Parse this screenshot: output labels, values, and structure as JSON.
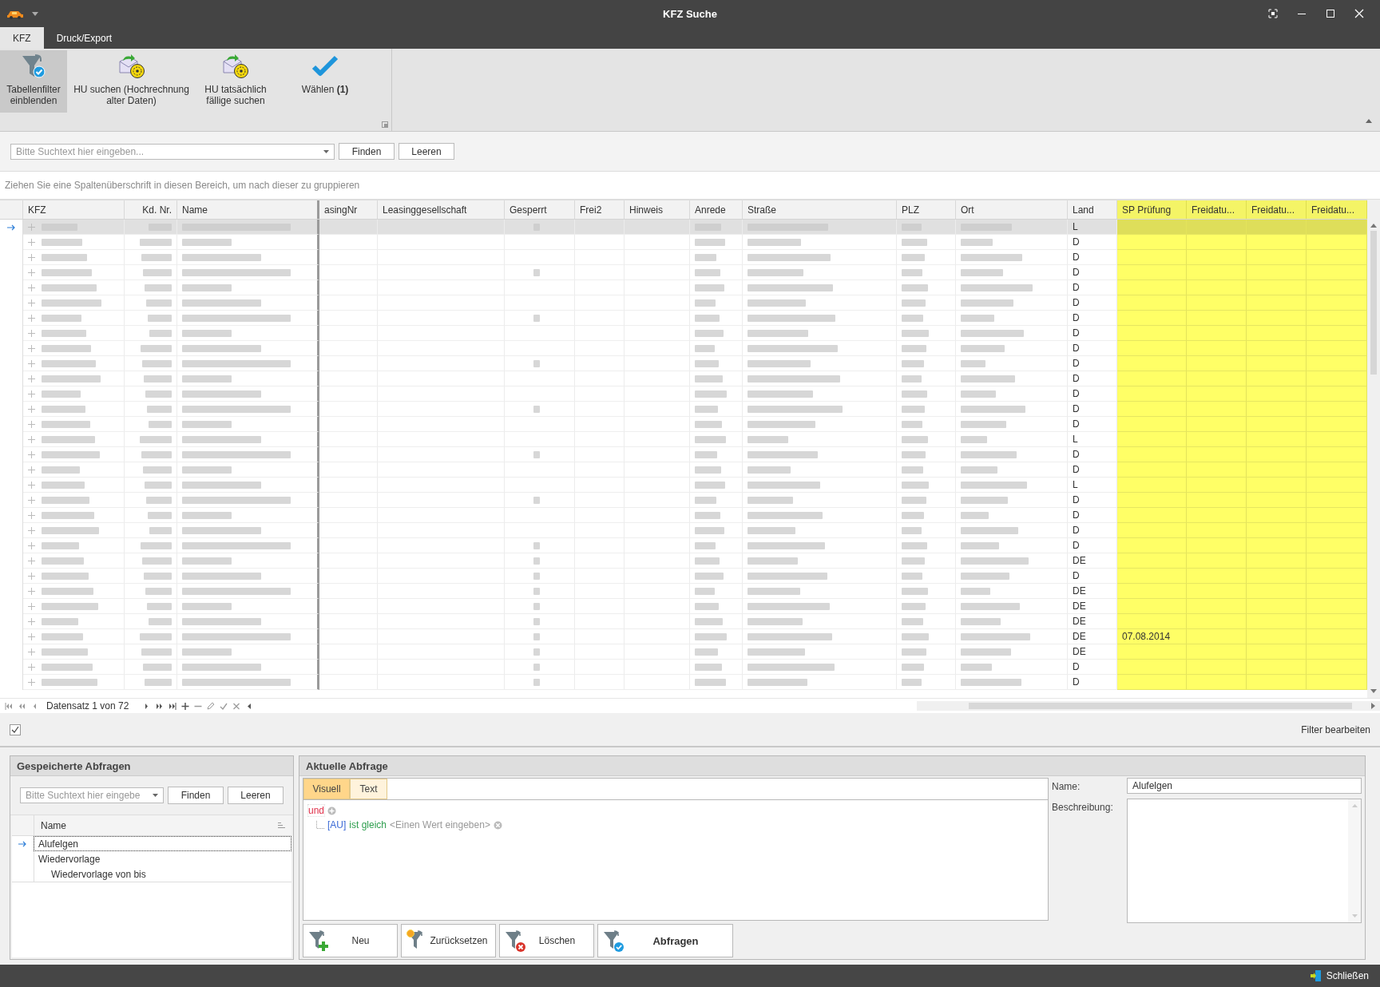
{
  "window": {
    "title": "KFZ Suche"
  },
  "ribbon_tabs": [
    {
      "label": "KFZ",
      "selected": true
    },
    {
      "label": "Druck/Export",
      "selected": false
    }
  ],
  "ribbon_buttons": [
    {
      "kind": "filter",
      "label": "Tabellenfilter\neinblenden",
      "selected": true
    },
    {
      "kind": "hu",
      "label": "HU suchen (Hochrechnung\nalter Daten)",
      "selected": false
    },
    {
      "kind": "hu",
      "label": "HU tatsächlich\nfällige suchen",
      "selected": false
    },
    {
      "kind": "check",
      "label": "Wählen **(1)**",
      "selected": false
    }
  ],
  "search": {
    "placeholder": "Bitte Suchtext hier eingeben...",
    "buttons": [
      "Finden",
      "Leeren"
    ]
  },
  "group_panel": {
    "hint": "Ziehen Sie eine Spaltenüberschrift in diesen Bereich, um nach dieser zu gruppieren"
  },
  "table": {
    "columns": [
      {
        "label": "KFZ",
        "highlighted": false
      },
      {
        "label": "Kd. Nr.",
        "highlighted": false
      },
      {
        "label": "Name",
        "highlighted": false
      },
      {
        "label": "asingNr",
        "highlighted": false
      },
      {
        "label": "Leasinggesellschaft",
        "highlighted": false
      },
      {
        "label": "Gesperrt",
        "highlighted": false
      },
      {
        "label": "Frei2",
        "highlighted": false
      },
      {
        "label": "Hinweis",
        "highlighted": false
      },
      {
        "label": "Anrede",
        "highlighted": false
      },
      {
        "label": "Straße",
        "highlighted": false
      },
      {
        "label": "PLZ",
        "highlighted": false
      },
      {
        "label": "Ort",
        "highlighted": false
      },
      {
        "label": "Land",
        "highlighted": false
      },
      {
        "label": "SP Prüfung",
        "highlighted": true
      },
      {
        "label": "Freidatu...",
        "highlighted": true
      },
      {
        "label": "Freidatu...",
        "highlighted": true
      },
      {
        "label": "Freidatu...",
        "highlighted": true
      }
    ],
    "rows": [
      {
        "selected": true,
        "land": "L"
      },
      {
        "selected": false,
        "land": "D"
      },
      {
        "selected": false,
        "land": "D"
      },
      {
        "selected": false,
        "land": "D"
      },
      {
        "selected": false,
        "land": "D"
      },
      {
        "selected": false,
        "land": "D"
      },
      {
        "selected": false,
        "land": "D"
      },
      {
        "selected": false,
        "land": "D"
      },
      {
        "selected": false,
        "land": "D"
      },
      {
        "selected": false,
        "land": "D"
      },
      {
        "selected": false,
        "land": "D"
      },
      {
        "selected": false,
        "land": "D"
      },
      {
        "selected": false,
        "land": "D"
      },
      {
        "selected": false,
        "land": "D"
      },
      {
        "selected": false,
        "land": "L"
      },
      {
        "selected": false,
        "land": "D"
      },
      {
        "selected": false,
        "land": "D"
      },
      {
        "selected": false,
        "land": "L"
      },
      {
        "selected": false,
        "land": "D"
      },
      {
        "selected": false,
        "land": "D"
      },
      {
        "selected": false,
        "land": "D"
      },
      {
        "selected": false,
        "land": "D"
      },
      {
        "selected": false,
        "land": "DE"
      },
      {
        "selected": false,
        "land": "D"
      },
      {
        "selected": false,
        "land": "DE"
      },
      {
        "selected": false,
        "land": "DE"
      },
      {
        "selected": false,
        "land": "DE"
      },
      {
        "selected": false,
        "land": "DE",
        "sp_pruefung": "07.08.2014"
      },
      {
        "selected": false,
        "land": "DE"
      },
      {
        "selected": false,
        "land": "D"
      },
      {
        "selected": false,
        "land": "D"
      }
    ]
  },
  "navigator": {
    "record": "Datensatz 1 von 72"
  },
  "filter_bar": {
    "checked": true,
    "link": "Filter bearbeiten"
  },
  "saved_queries": {
    "title": "Gespeicherte Abfragen",
    "search": {
      "placeholder": "Bitte Suchtext hier eingebe",
      "buttons": [
        "Finden",
        "Leeren"
      ]
    },
    "column": "Name",
    "items": [
      {
        "label": "Alufelgen",
        "selected": true
      },
      {
        "label": "Wiedervorlage",
        "selected": false,
        "children": [
          {
            "label": "Wiedervorlage von bis",
            "selected": false
          }
        ]
      }
    ]
  },
  "current_query": {
    "title": "Aktuelle Abfrage",
    "tabs": [
      {
        "label": "Visuell",
        "selected": true
      },
      {
        "label": "Text",
        "selected": false
      }
    ],
    "operator": "und",
    "conditions": [
      {
        "field": "[AU]",
        "operation": "ist gleich",
        "value": "<Einen Wert eingeben>"
      }
    ],
    "buttons": [
      {
        "kind": "new",
        "label": "Neu"
      },
      {
        "kind": "reset",
        "label": "Zurücksetzen"
      },
      {
        "kind": "delete",
        "label": "Löschen"
      },
      {
        "kind": "query",
        "label": "Abfragen"
      }
    ],
    "name_label": "Name:",
    "name_value": "Alufelgen",
    "description_label": "Beschreibung:"
  },
  "status_bar": {
    "close": "Schließen"
  }
}
